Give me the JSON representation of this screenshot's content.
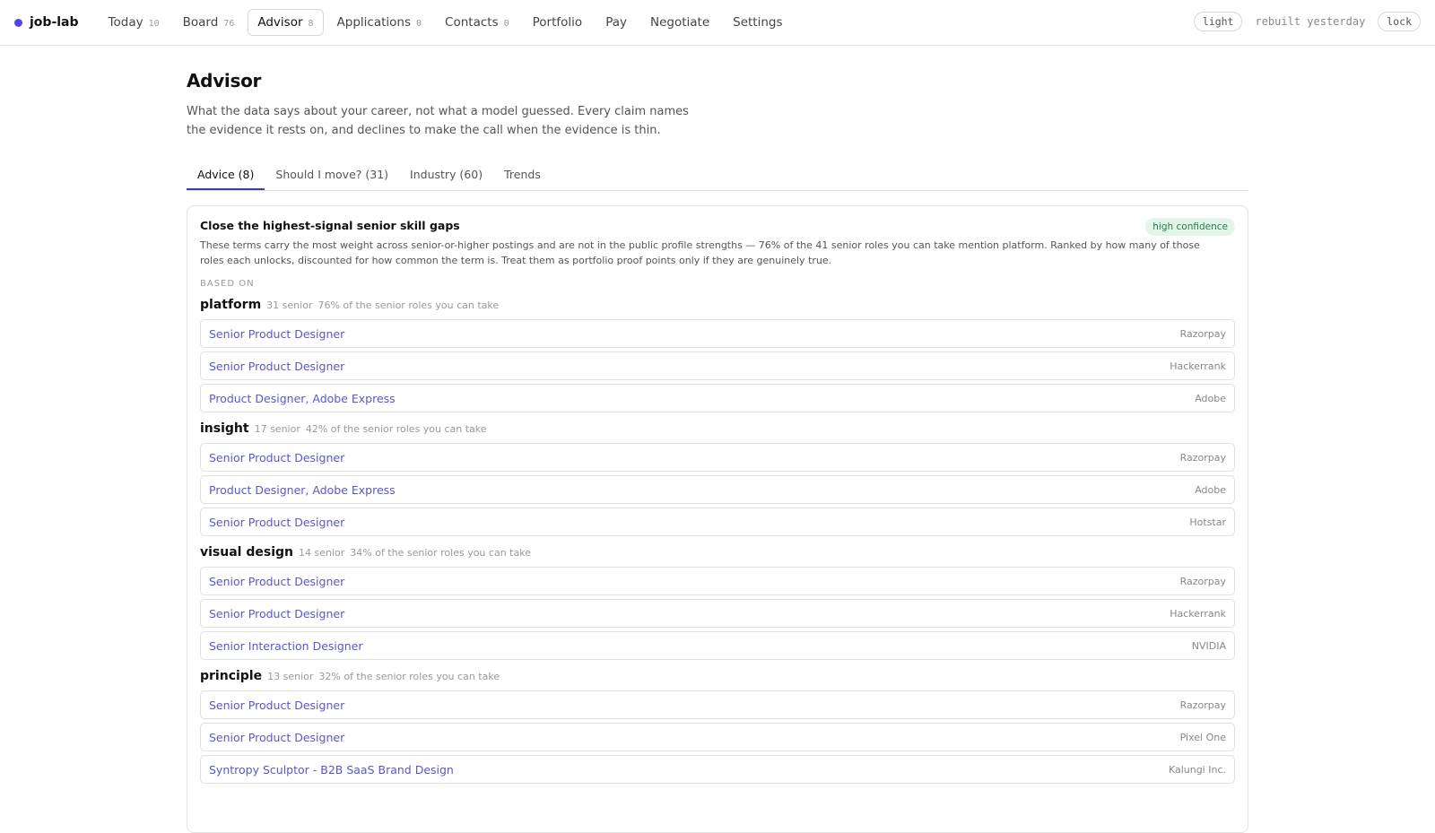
{
  "app": {
    "name": "job-lab",
    "accent": "#5046e5"
  },
  "nav": [
    {
      "label": "Today",
      "count": "10"
    },
    {
      "label": "Board",
      "count": "76"
    },
    {
      "label": "Advisor",
      "count": "8",
      "active": true
    },
    {
      "label": "Applications",
      "count": "0"
    },
    {
      "label": "Contacts",
      "count": "0"
    },
    {
      "label": "Portfolio"
    },
    {
      "label": "Pay"
    },
    {
      "label": "Negotiate"
    },
    {
      "label": "Settings"
    }
  ],
  "top_right": {
    "theme_label": "light",
    "status": "rebuilt yesterday",
    "lock_label": "lock"
  },
  "page": {
    "title": "Advisor",
    "description": "What the data says about your career, not what a model guessed. Every claim names the evidence it rests on, and declines to make the call when the evidence is thin."
  },
  "tabs": [
    {
      "label": "Advice (8)",
      "active": true
    },
    {
      "label": "Should I move? (31)"
    },
    {
      "label": "Industry (60)"
    },
    {
      "label": "Trends"
    }
  ],
  "card": {
    "title": "Close the highest-signal senior skill gaps",
    "confidence": "high confidence",
    "description": "These terms carry the most weight across senior-or-higher postings and are not in the public profile strengths — 76% of the 41 senior roles you can take mention platform. Ranked by how many of those roles each unlocks, discounted for how common the term is. Treat them as portfolio proof points only if they are genuinely true.",
    "based_on_label": "BASED ON",
    "groups": [
      {
        "term": "platform",
        "senior": "31 senior",
        "share": "76% of the senior roles you can take",
        "roles": [
          {
            "title": "Senior Product Designer",
            "company": "Razorpay"
          },
          {
            "title": "Senior Product Designer",
            "company": "Hackerrank"
          },
          {
            "title": "Product Designer, Adobe Express",
            "company": "Adobe"
          }
        ]
      },
      {
        "term": "insight",
        "senior": "17 senior",
        "share": "42% of the senior roles you can take",
        "roles": [
          {
            "title": "Senior Product Designer",
            "company": "Razorpay"
          },
          {
            "title": "Product Designer, Adobe Express",
            "company": "Adobe"
          },
          {
            "title": "Senior Product Designer",
            "company": "Hotstar"
          }
        ]
      },
      {
        "term": "visual design",
        "senior": "14 senior",
        "share": "34% of the senior roles you can take",
        "roles": [
          {
            "title": "Senior Product Designer",
            "company": "Razorpay"
          },
          {
            "title": "Senior Product Designer",
            "company": "Hackerrank"
          },
          {
            "title": "Senior Interaction Designer",
            "company": "NVIDIA"
          }
        ]
      },
      {
        "term": "principle",
        "senior": "13 senior",
        "share": "32% of the senior roles you can take",
        "roles": [
          {
            "title": "Senior Product Designer",
            "company": "Razorpay"
          },
          {
            "title": "Senior Product Designer",
            "company": "Pixel One"
          },
          {
            "title": "Syntropy Sculptor - B2B SaaS Brand Design",
            "company": "Kalungi Inc."
          }
        ]
      }
    ]
  }
}
